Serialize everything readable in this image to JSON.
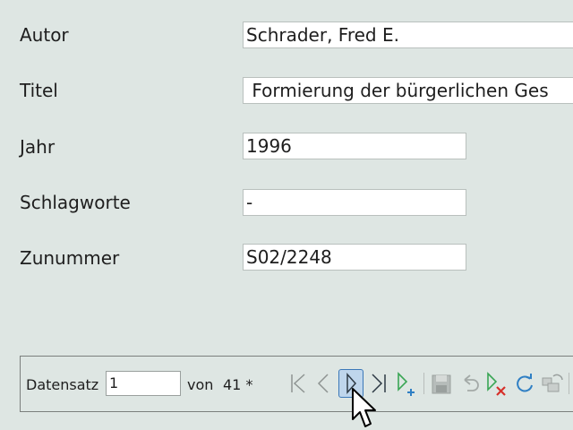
{
  "form": {
    "fields": [
      {
        "label": "Autor",
        "value": "Schrader, Fred E."
      },
      {
        "label": "Titel",
        "value": " Formierung der bürgerlichen Ges"
      },
      {
        "label": "Jahr",
        "value": "1996"
      },
      {
        "label": "Schlagworte",
        "value": "-"
      },
      {
        "label": "Zunummer",
        "value": "S02/2248"
      }
    ]
  },
  "navigation": {
    "record_label": "Datensatz",
    "record_value": "1",
    "of_label": "von",
    "total": "41 *",
    "buttons": [
      {
        "icon": "first-record-icon"
      },
      {
        "icon": "previous-record-icon"
      },
      {
        "icon": "next-record-icon"
      },
      {
        "icon": "last-record-icon"
      },
      {
        "icon": "new-record-icon"
      },
      {
        "icon": "save-record-icon"
      },
      {
        "icon": "undo-icon"
      },
      {
        "icon": "delete-record-icon"
      },
      {
        "icon": "refresh-icon"
      },
      {
        "icon": "refresh-control-icon"
      }
    ]
  },
  "colors": {
    "background": "#dee6e3",
    "accent_blue": "#3b78b8",
    "accent_green": "#3aa655",
    "delete_red": "#d6302a"
  }
}
